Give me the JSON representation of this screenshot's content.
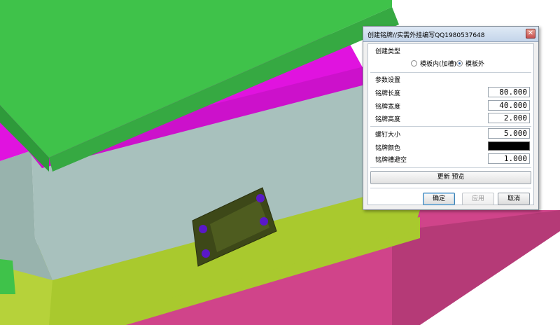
{
  "dialog": {
    "title": "创建铭牌//实需外挂编写QQ1980537648",
    "close_glyph": "✕",
    "create_type": {
      "label": "创建类型",
      "options": [
        {
          "label": "模板内(加槽)",
          "selected": false
        },
        {
          "label": "模板外",
          "selected": true
        }
      ]
    },
    "params": {
      "label": "参数设置",
      "plate_length": {
        "label": "铭牌长度",
        "value": "80.000"
      },
      "plate_width": {
        "label": "铭牌宽度",
        "value": "40.000"
      },
      "plate_height": {
        "label": "铭牌高度",
        "value": "2.000"
      },
      "screw_size": {
        "label": "螺钉大小",
        "value": "5.000"
      },
      "plate_color": {
        "label": "铭牌颜色",
        "color": "#000000"
      },
      "slot_clearance": {
        "label": "铭牌槽避空",
        "value": "1.000"
      }
    },
    "update_preview": "更新   预览",
    "ok": "确定",
    "apply": "应用",
    "cancel": "取消"
  },
  "scene": {
    "colors": {
      "top_plate": "#3fc24a",
      "magenta_plate": "#e013df",
      "gray_plate": "#a8c1bd",
      "lime_plate": "#a9c92e",
      "pink_base": "#d0448a",
      "nameplate": "#3d4818",
      "screw": "#5a18c8"
    }
  }
}
